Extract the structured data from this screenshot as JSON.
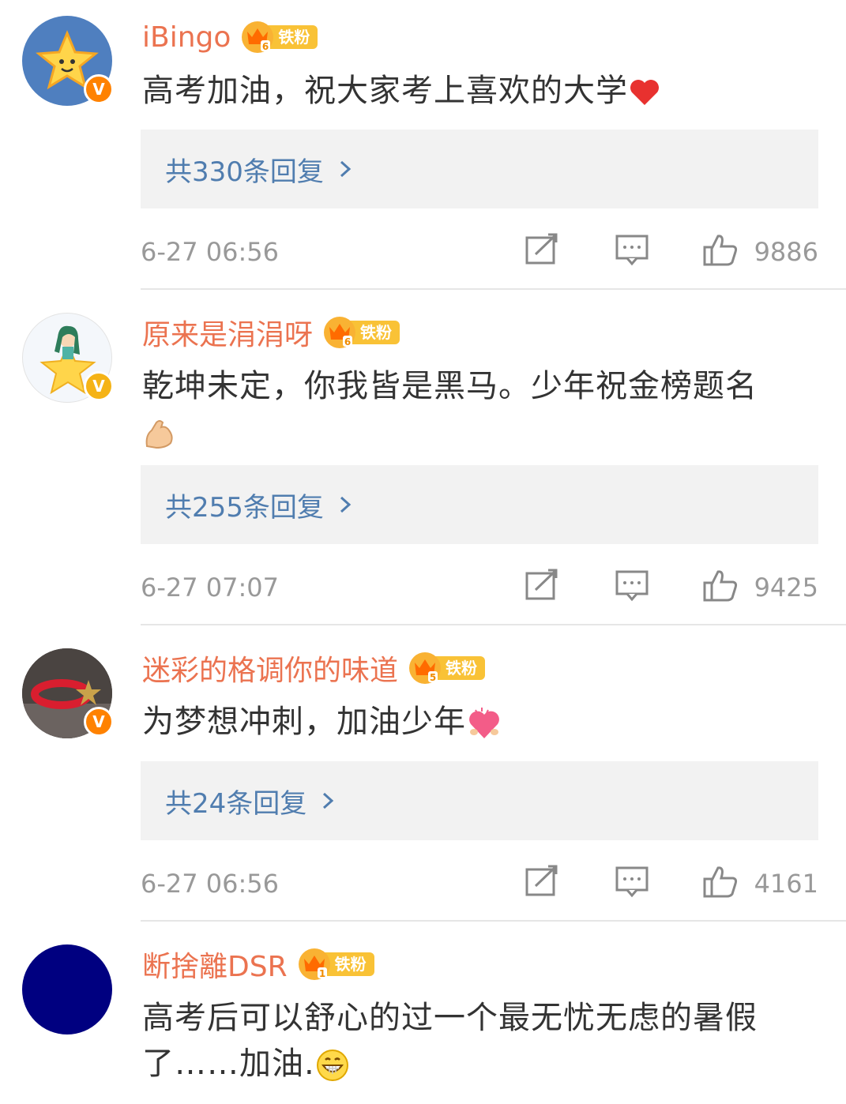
{
  "fan_badge_label": "铁粉",
  "comments": [
    {
      "username": "iBingo",
      "fan_level": "6",
      "text": "高考加油，祝大家考上喜欢的大学",
      "emoji": "heart",
      "replies": "共330条回复",
      "time": "6-27 06:56",
      "likes": "9886"
    },
    {
      "username": "原来是涓涓呀",
      "fan_level": "6",
      "text": "乾坤未定，你我皆是黑马。少年祝金榜题名",
      "emoji": "muscle",
      "replies": "共255条回复",
      "time": "6-27 07:07",
      "likes": "9425"
    },
    {
      "username": "迷彩的格调你的味道",
      "fan_level": "5",
      "text": "为梦想冲刺，加油少年",
      "emoji": "love-heart",
      "replies": "共24条回复",
      "time": "6-27 06:56",
      "likes": "4161"
    },
    {
      "username": "断捨離DSR",
      "fan_level": "1",
      "text": "高考后可以舒心的过一个最无忧无虑的暑假了……加油.",
      "emoji": "grin",
      "replies": "",
      "time": "",
      "likes": ""
    }
  ],
  "colors": {
    "username": "#eb7350",
    "reply_link": "#507daf",
    "meta": "#999999",
    "badge_gold": "#f9c236"
  }
}
